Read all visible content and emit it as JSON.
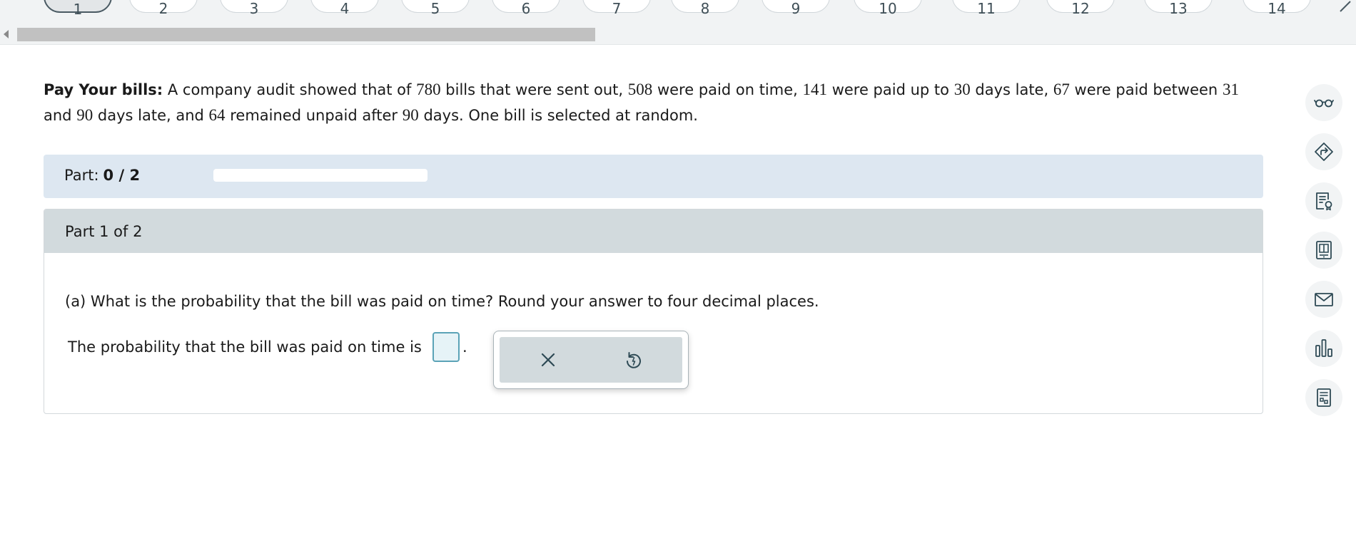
{
  "nav": {
    "questions": [
      {
        "number": "1",
        "current": true
      },
      {
        "number": "2"
      },
      {
        "number": "3"
      },
      {
        "number": "4"
      },
      {
        "number": "5"
      },
      {
        "number": "6"
      },
      {
        "number": "7"
      },
      {
        "number": "8"
      },
      {
        "number": "9"
      },
      {
        "number": "10"
      },
      {
        "number": "11"
      },
      {
        "number": "12"
      },
      {
        "number": "13"
      },
      {
        "number": "14"
      }
    ],
    "next_icon": "chevron-right-icon"
  },
  "problem": {
    "lead": "Pay Your bills:",
    "t1": "A company audit showed that of",
    "n1": "780",
    "t2": "bills that were sent out,",
    "n2": "508",
    "t3": "were paid on time,",
    "n3": "141",
    "t4": "were paid up to",
    "n4": "30",
    "t5": "days late,",
    "n5": "67",
    "t6": "were paid between",
    "n6": "31",
    "t7": "and",
    "n7": "90",
    "t8": "days late, and",
    "n8": "64",
    "t9": "remained unpaid after",
    "n9": "90",
    "t10": "days. One bill is selected at random."
  },
  "part_progress": {
    "label": "Part:",
    "value": "0 / 2",
    "fraction": 0
  },
  "part": {
    "heading": "Part 1 of 2",
    "question": "(a) What is the probability that the bill was paid on time? Round your answer to four decimal places.",
    "answer_prefix": "The probability that the bill was paid on time is",
    "answer_value": "",
    "answer_suffix": "."
  },
  "answer_tools": [
    {
      "icon": "close-icon",
      "action": "clear"
    },
    {
      "icon": "undo-icon",
      "action": "undo"
    }
  ],
  "side_tools": [
    "glasses-icon",
    "directions-icon",
    "notes-icon",
    "book-icon",
    "mail-icon",
    "bar-chart-icon",
    "calculator-icon"
  ],
  "colors": {
    "part_bar_bg": "#dde7f1",
    "card_header_bg": "#d2dadd",
    "input_border": "#5ba3b7",
    "icon_color": "#2e4a55"
  }
}
